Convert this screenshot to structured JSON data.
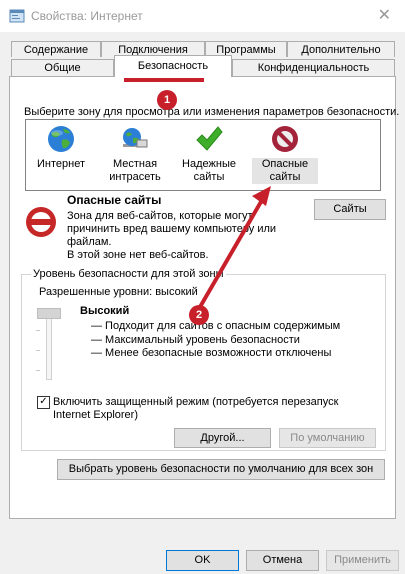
{
  "window": {
    "title": "Свойства: Интернет",
    "close_glyph": "✕"
  },
  "tabs": {
    "row1": [
      "Содержание",
      "Подключения",
      "Программы",
      "Дополнительно"
    ],
    "row2": [
      "Общие",
      "Безопасность",
      "Конфиденциальность"
    ],
    "active": "Безопасность"
  },
  "zones": {
    "prompt": "Выберите зону для просмотра или изменения параметров безопасности.",
    "items": [
      {
        "label1": "Интернет",
        "label2": "",
        "icon": "globe-icon"
      },
      {
        "label1": "Местная",
        "label2": "интрасеть",
        "icon": "intranet-icon"
      },
      {
        "label1": "Надежные",
        "label2": "сайты",
        "icon": "checkmark-icon"
      },
      {
        "label1": "Опасные",
        "label2": "сайты",
        "icon": "restricted-icon"
      }
    ],
    "selected_index": 3
  },
  "zone_info": {
    "title": "Опасные сайты",
    "desc1": "Зона для веб-сайтов, которые могут",
    "desc2": "причинить вред вашему компьютеру или",
    "desc3": "файлам.",
    "desc4": "В этой зоне нет веб-сайтов.",
    "sites_button": "Сайты"
  },
  "security_level": {
    "group_label": "Уровень безопасности для этой зоны",
    "allowed": "Разрешенные уровни: высокий",
    "level": "Высокий",
    "bullets": [
      "— Подходит для сайтов с опасным содержимым",
      "— Максимальный уровень безопасности",
      "— Менее безопасные возможности отключены"
    ],
    "level_fraction": 1.0
  },
  "protected_mode": {
    "checked": true,
    "check_glyph": "✓",
    "label_line1": "Включить защищенный режим (потребуется перезапуск",
    "label_line2": "Internet Explorer)"
  },
  "buttons": {
    "other": "Другой...",
    "default": "По умолчанию",
    "reset_all": "Выбрать уровень безопасности по умолчанию для всех зон",
    "ok": "OK",
    "cancel": "Отмена",
    "apply": "Применить"
  },
  "annotations": {
    "marker1": "1",
    "marker2": "2",
    "color": "#c8202b"
  }
}
